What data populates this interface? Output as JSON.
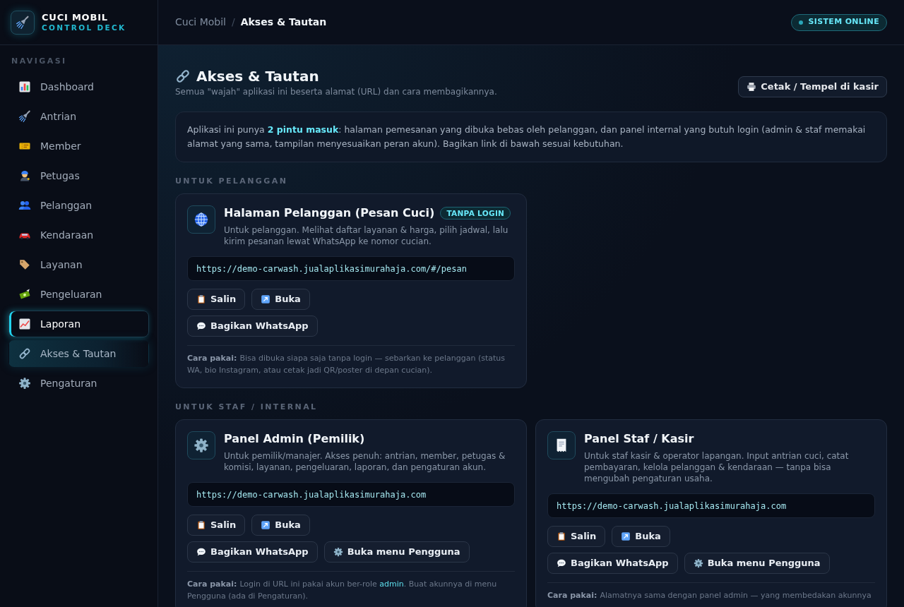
{
  "sidebar": {
    "brand": {
      "title": "CUCI MOBIL",
      "subtitle": "CONTROL DECK"
    },
    "section_label": "NAVIGASI",
    "items": [
      {
        "label": "Dashboard",
        "selected": false,
        "focused": false
      },
      {
        "label": "Antrian",
        "selected": false,
        "focused": false
      },
      {
        "label": "Member",
        "selected": false,
        "focused": false
      },
      {
        "label": "Petugas",
        "selected": false,
        "focused": false
      },
      {
        "label": "Pelanggan",
        "selected": false,
        "focused": false
      },
      {
        "label": "Kendaraan",
        "selected": false,
        "focused": false
      },
      {
        "label": "Layanan",
        "selected": false,
        "focused": false
      },
      {
        "label": "Pengeluaran",
        "selected": false,
        "focused": false
      },
      {
        "label": "Laporan",
        "selected": false,
        "focused": true
      },
      {
        "label": "Akses & Tautan",
        "selected": true,
        "focused": false
      },
      {
        "label": "Pengaturan",
        "selected": false,
        "focused": false
      }
    ]
  },
  "header": {
    "breadcrumb": [
      "Cuci Mobil",
      "Akses & Tautan"
    ],
    "separator": "/",
    "status_badge": "SISTEM ONLINE"
  },
  "page": {
    "title": "Akses & Tautan",
    "subtitle": "Semua \"wajah\" aplikasi ini beserta alamat (URL) dan cara membagikannya.",
    "print_button": "Cetak / Tempel di kasir",
    "intro": "Aplikasi ini punya **2 pintu masuk**: halaman pemesanan yang dibuka bebas oleh pelanggan, dan panel internal yang butuh login (admin & staf memakai alamat yang sama, tampilan menyesuaikan peran akun). Bagikan link di bawah sesuai kebutuhan."
  },
  "sections": [
    {
      "label": "UNTUK PELANGGAN",
      "cards": [
        {
          "title": "Halaman Pelanggan (Pesan Cuci)",
          "badge": "TANPA LOGIN",
          "description": "Untuk pelanggan. Melihat daftar layanan & harga, pilih jadwal, lalu kirim pesanan lewat WhatsApp ke nomor cucian.",
          "url": "https://demo-carwash.jualaplikasimurahaja.com/#/pesan",
          "button_rows": [
            [
              {
                "kind": "copy",
                "label": "Salin"
              },
              {
                "kind": "open",
                "label": "Buka"
              }
            ],
            [
              {
                "kind": "share",
                "label": "Bagikan WhatsApp"
              }
            ]
          ],
          "note": {
            "label": "Cara pakai:",
            "parts": [
              {
                "kind": "plain",
                "text": "Bisa dibuka siapa saja tanpa login — sebarkan ke pelanggan (status WA, bio Instagram, atau cetak jadi QR/poster di depan cucian)."
              }
            ]
          }
        }
      ]
    },
    {
      "label": "UNTUK STAF / INTERNAL",
      "cards": [
        {
          "title": "Panel Admin (Pemilik)",
          "description": "Untuk pemilik/manajer. Akses penuh: antrian, member, petugas & komisi, layanan, pengeluaran, laporan, dan pengaturan akun.",
          "url": "https://demo-carwash.jualaplikasimurahaja.com",
          "button_rows": [
            [
              {
                "kind": "copy",
                "label": "Salin"
              },
              {
                "kind": "open",
                "label": "Buka"
              }
            ],
            [
              {
                "kind": "share",
                "label": "Bagikan WhatsApp"
              },
              {
                "kind": "users",
                "label": "Buka menu Pengguna"
              }
            ]
          ],
          "note": {
            "label": "Cara pakai:",
            "parts": [
              {
                "kind": "plain",
                "text": "Login di URL ini pakai akun ber-role "
              },
              {
                "kind": "highlight",
                "text": "admin"
              },
              {
                "kind": "plain",
                "text": ". Buat akunnya di menu Pengguna (ada di Pengaturan)."
              }
            ]
          }
        },
        {
          "title": "Panel Staf / Kasir",
          "description": "Untuk staf kasir & operator lapangan. Input antrian cuci, catat pembayaran, kelola pelanggan & kendaraan — tanpa bisa mengubah pengaturan usaha.",
          "url": "https://demo-carwash.jualaplikasimurahaja.com",
          "button_rows": [
            [
              {
                "kind": "copy",
                "label": "Salin"
              },
              {
                "kind": "open",
                "label": "Buka"
              }
            ],
            [
              {
                "kind": "share",
                "label": "Bagikan WhatsApp"
              },
              {
                "kind": "users",
                "label": "Buka menu Pengguna"
              }
            ]
          ],
          "note": {
            "label": "Cara pakai:",
            "parts": [
              {
                "kind": "plain",
                "text": "Alamatnya sama dengan panel admin — yang membedakan akunnya"
              }
            ]
          }
        }
      ]
    }
  ]
}
